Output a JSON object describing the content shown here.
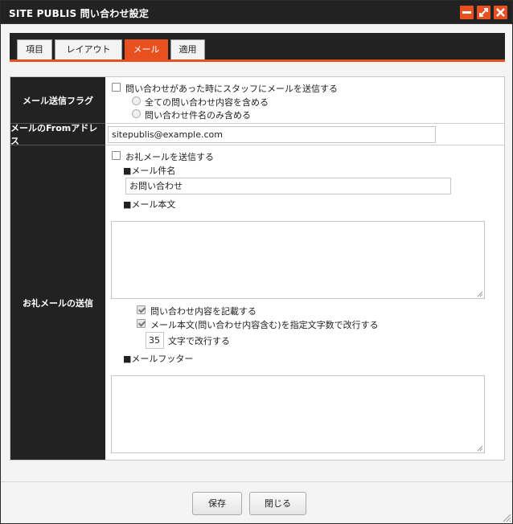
{
  "window": {
    "title": "SITE PUBLIS 問い合わせ設定",
    "accent_color": "#e8501f",
    "dark_color": "#222222"
  },
  "tabs": [
    {
      "label": "項目",
      "active": false
    },
    {
      "label": "レイアウト",
      "active": false
    },
    {
      "label": "メール",
      "active": true
    },
    {
      "label": "適用",
      "active": false
    }
  ],
  "mail_flag": {
    "label": "メール送信フラグ",
    "checkbox_label": "問い合わせがあった時にスタッフにメールを送信する",
    "checked": false,
    "radio_options": [
      "全ての問い合わせ内容を含める",
      "問い合わせ件名のみ含める"
    ]
  },
  "from_address": {
    "label": "メールのFromアドレス",
    "value": "sitepublis@example.com"
  },
  "thanks_mail": {
    "label": "お礼メールの送信",
    "send_checkbox_label": "お礼メールを送信する",
    "send_checked": false,
    "subject_heading": "■メール件名",
    "subject_value": "お問い合わせ",
    "body_heading": "■メール本文",
    "body_value": "",
    "include_content_label": "問い合わせ内容を記載する",
    "include_content_checked": true,
    "wrap_label": "メール本文(問い合わせ内容含む)を指定文字数で改行する",
    "wrap_checked": true,
    "wrap_chars_value": "35",
    "wrap_chars_suffix": "文字で改行する",
    "footer_heading": "■メールフッター",
    "footer_value": ""
  },
  "buttons": {
    "save": "保存",
    "close": "閉じる"
  },
  "icons": [
    "minimize-icon",
    "maximize-icon",
    "close-icon",
    "resize-grip-icon"
  ]
}
